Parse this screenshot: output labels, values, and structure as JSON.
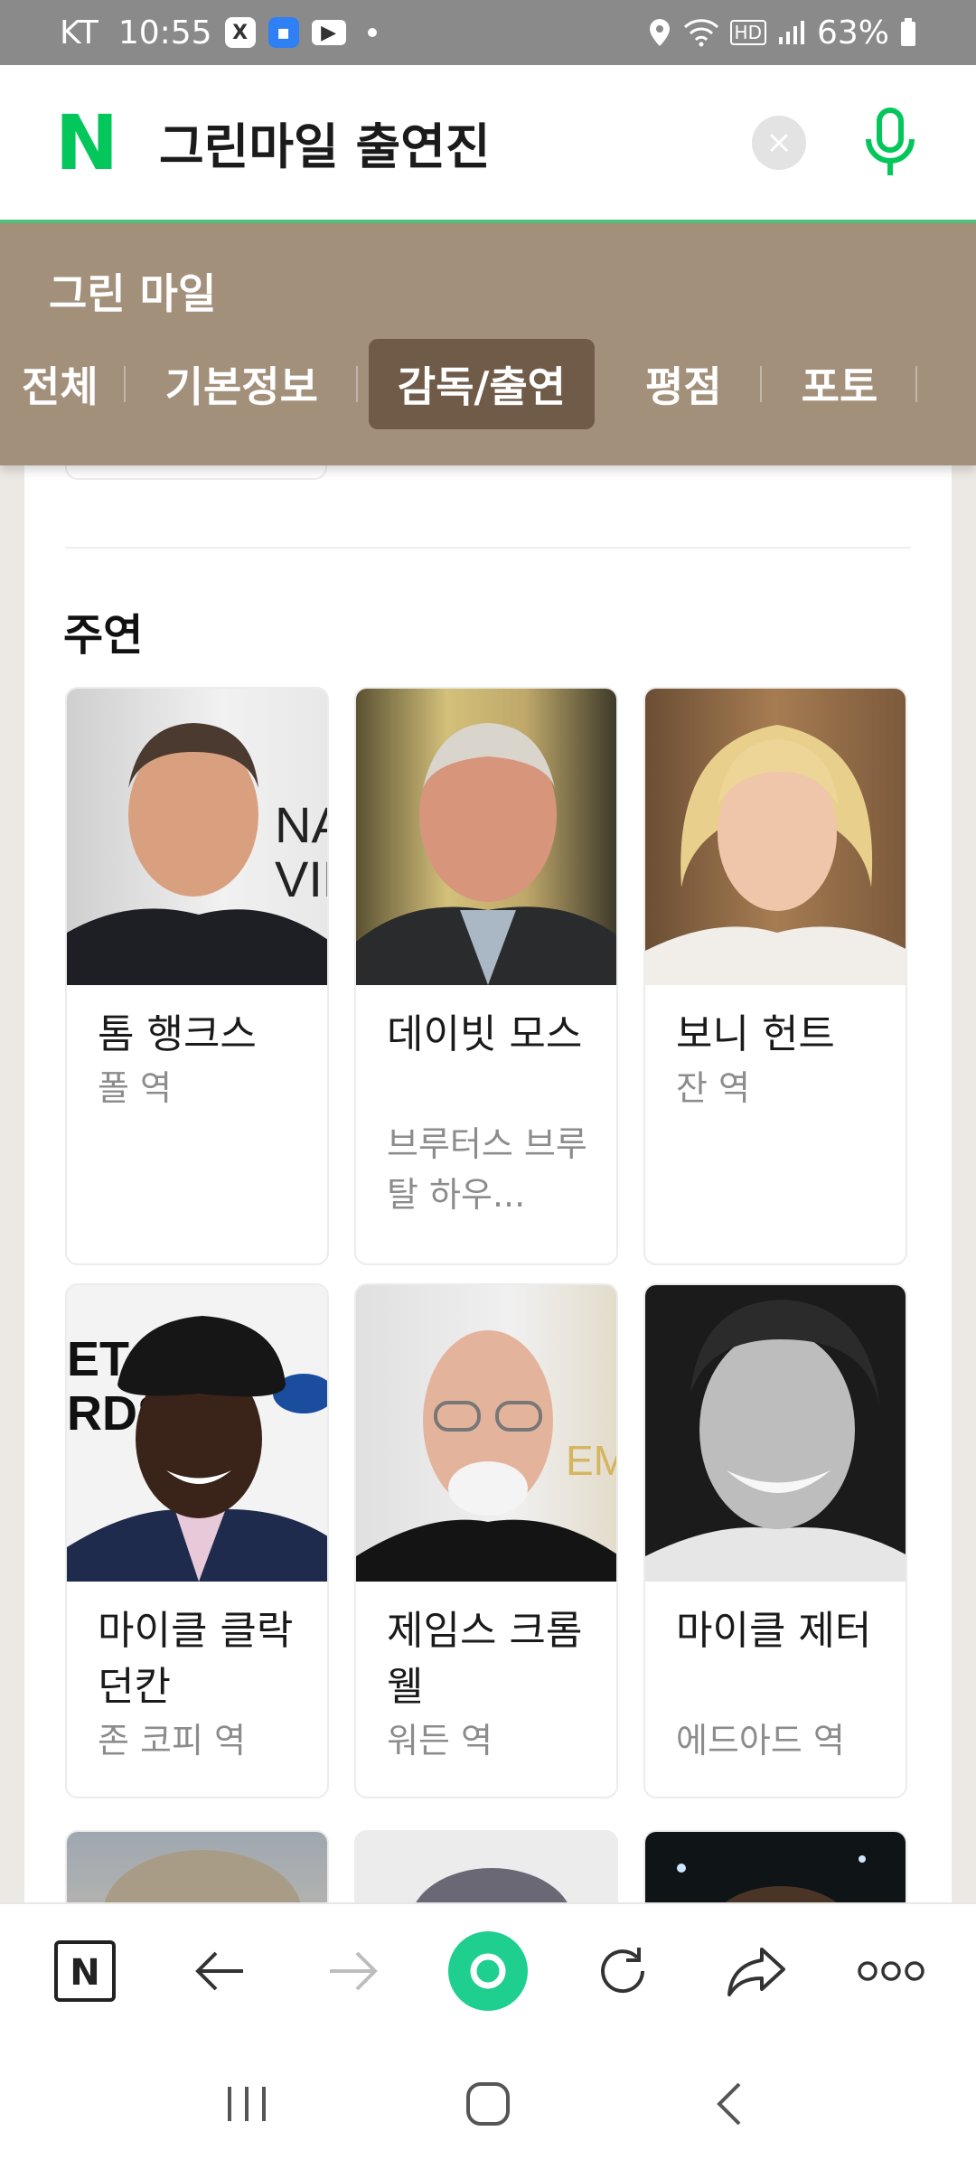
{
  "status_bar": {
    "carrier": "KT",
    "time": "10:55",
    "battery": "63%"
  },
  "search": {
    "query": "그린마일 출연진"
  },
  "movie": {
    "title": "그린 마일",
    "tabs": [
      {
        "label": "전체",
        "active": false
      },
      {
        "label": "기본정보",
        "active": false
      },
      {
        "label": "감독/출연",
        "active": true
      },
      {
        "label": "평점",
        "active": false
      },
      {
        "label": "포토",
        "active": false
      }
    ]
  },
  "cast_section": {
    "title": "주연",
    "members": [
      {
        "name": "톰 행크스",
        "role": "폴 역"
      },
      {
        "name": "데이빗 모스",
        "role": "브루터스 브루탈 하우..."
      },
      {
        "name": "보니 헌트",
        "role": "잔 역"
      },
      {
        "name": "마이클 클락 던칸",
        "role": "존 코피 역"
      },
      {
        "name": "제임스 크롬웰",
        "role": "워든 역"
      },
      {
        "name": "마이클 제터",
        "role": "에드아드 역"
      }
    ]
  },
  "colors": {
    "naver_green": "#03c75a",
    "header_brown": "#a3907b",
    "active_tab": "#6f5b48"
  },
  "icons": {
    "toolbar": [
      "naver-home-icon",
      "back-arrow-icon",
      "forward-arrow-icon",
      "green-dot-icon",
      "refresh-icon",
      "share-icon",
      "more-icon"
    ],
    "nav": [
      "recents-icon",
      "home-icon",
      "back-icon"
    ]
  }
}
